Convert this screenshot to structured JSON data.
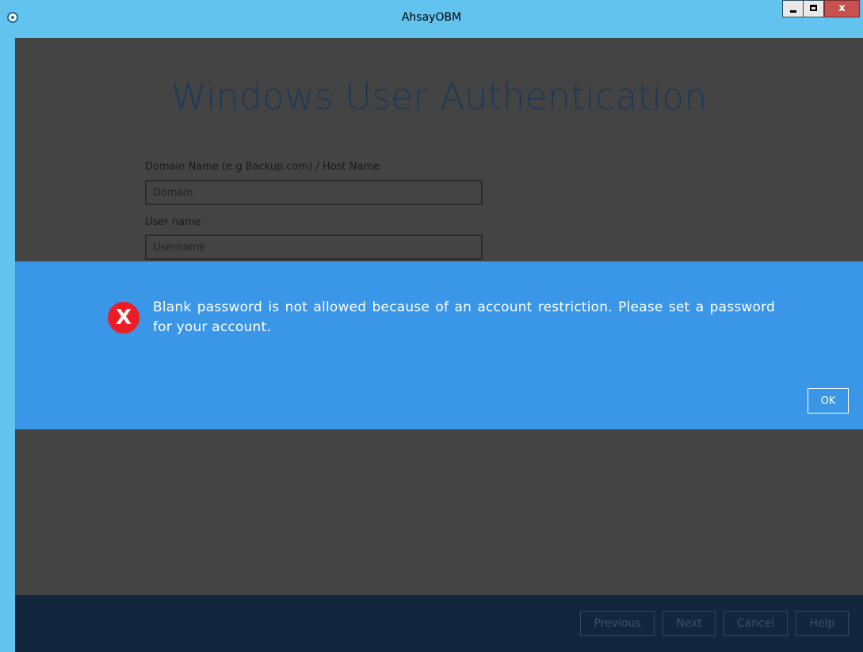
{
  "window": {
    "title": "AhsayOBM",
    "icons": {
      "app": "app-logo-icon",
      "minimize": "minimize-icon",
      "maximize": "maximize-icon",
      "close": "close-icon"
    },
    "close_glyph": "x"
  },
  "page": {
    "title": "Windows User Authentication",
    "domain_label": "Domain Name (e.g Backup.com) / Host Name",
    "domain_placeholder": "Domain",
    "username_label": "User name",
    "username_placeholder": "Username"
  },
  "dialog": {
    "icon": "error-icon",
    "icon_glyph": "X",
    "message": "Blank password is not allowed because of an account restriction. Please set a password for your account.",
    "ok_label": "OK"
  },
  "footer": {
    "previous_label": "Previous",
    "next_label": "Next",
    "cancel_label": "Cancel",
    "help_label": "Help"
  },
  "colors": {
    "title_bar": "#62c4ee",
    "content_bg": "#444444",
    "dialog_bg": "#3a96e7",
    "footer_bg": "#12263e",
    "error_red": "#ee1d25"
  }
}
